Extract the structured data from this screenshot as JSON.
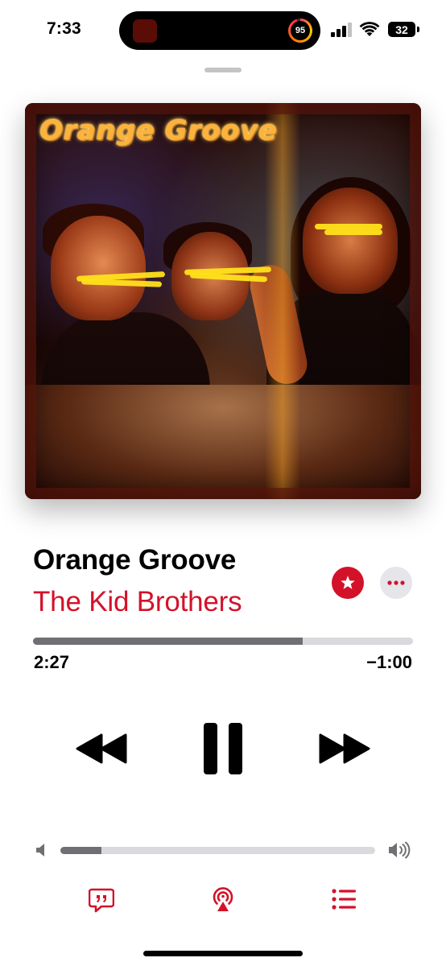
{
  "status_bar": {
    "time": "7:33",
    "activity_ring_value": "95",
    "battery_level": "32"
  },
  "artwork": {
    "overlay_text": "Orange Groove"
  },
  "track": {
    "title": "Orange Groove",
    "artist": "The Kid Brothers",
    "accent_color": "#d3122a"
  },
  "playback": {
    "elapsed": "2:27",
    "remaining": "−1:00",
    "progress_fraction": 0.71,
    "state": "playing"
  },
  "volume": {
    "level_fraction": 0.13
  },
  "icons": {
    "favorite": "star-icon",
    "more": "ellipsis-icon",
    "rewind": "backward-icon",
    "pause": "pause-icon",
    "forward": "forward-icon",
    "lyrics": "quote-bubble-icon",
    "airplay": "airplay-icon",
    "queue": "list-icon"
  }
}
